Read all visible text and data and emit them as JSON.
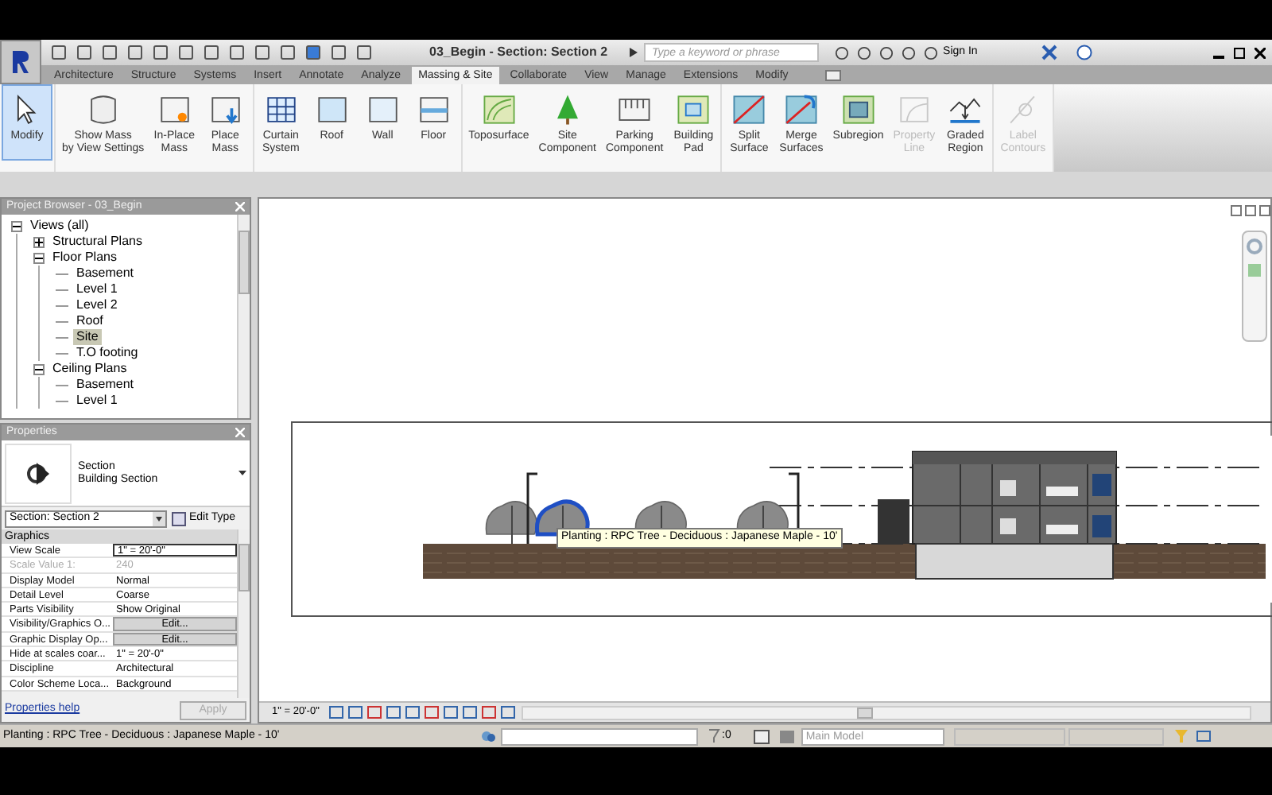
{
  "title_bar": {
    "document_title": "03_Begin - Section: Section 2",
    "search_placeholder": "Type a keyword or phrase",
    "sign_in": "Sign In"
  },
  "tabs": [
    {
      "label": "Architecture",
      "selected": false
    },
    {
      "label": "Structure",
      "selected": false
    },
    {
      "label": "Systems",
      "selected": false
    },
    {
      "label": "Insert",
      "selected": false
    },
    {
      "label": "Annotate",
      "selected": false
    },
    {
      "label": "Analyze",
      "selected": false
    },
    {
      "label": "Massing & Site",
      "selected": true
    },
    {
      "label": "Collaborate",
      "selected": false
    },
    {
      "label": "View",
      "selected": false
    },
    {
      "label": "Manage",
      "selected": false
    },
    {
      "label": "Extensions",
      "selected": false
    },
    {
      "label": "Modify",
      "selected": false
    }
  ],
  "ribbon": {
    "groups": [
      {
        "tools": [
          {
            "kind": "modify",
            "lines": [
              "Modify"
            ],
            "disabled": false,
            "selected": true
          }
        ]
      },
      {
        "tools": [
          {
            "kind": "mass",
            "lines": [
              "Show Mass",
              "by View Settings"
            ],
            "disabled": false,
            "selected": false
          },
          {
            "kind": "inplace",
            "lines": [
              "In-Place",
              "Mass"
            ],
            "disabled": false,
            "selected": false
          },
          {
            "kind": "place",
            "lines": [
              "Place",
              "Mass"
            ],
            "disabled": false,
            "selected": false
          }
        ]
      },
      {
        "tools": [
          {
            "kind": "curtain",
            "lines": [
              "Curtain",
              "System"
            ],
            "disabled": false,
            "selected": false
          },
          {
            "kind": "roof",
            "lines": [
              "Roof"
            ],
            "disabled": false,
            "selected": false
          },
          {
            "kind": "wall",
            "lines": [
              "Wall"
            ],
            "disabled": false,
            "selected": false
          },
          {
            "kind": "floor",
            "lines": [
              "Floor"
            ],
            "disabled": false,
            "selected": false
          }
        ]
      },
      {
        "tools": [
          {
            "kind": "topo",
            "lines": [
              "Toposurface"
            ],
            "disabled": false,
            "selected": false
          },
          {
            "kind": "tree",
            "lines": [
              "Site",
              "Component"
            ],
            "disabled": false,
            "selected": false
          },
          {
            "kind": "parking",
            "lines": [
              "Parking",
              "Component"
            ],
            "disabled": false,
            "selected": false
          },
          {
            "kind": "pad",
            "lines": [
              "Building",
              "Pad"
            ],
            "disabled": false,
            "selected": false
          }
        ]
      },
      {
        "tools": [
          {
            "kind": "split",
            "lines": [
              "Split",
              "Surface"
            ],
            "disabled": false,
            "selected": false
          },
          {
            "kind": "merge",
            "lines": [
              "Merge",
              "Surfaces"
            ],
            "disabled": false,
            "selected": false
          },
          {
            "kind": "subregion",
            "lines": [
              "Subregion"
            ],
            "disabled": false,
            "selected": false
          },
          {
            "kind": "propline",
            "lines": [
              "Property",
              "Line"
            ],
            "disabled": true,
            "selected": false
          },
          {
            "kind": "graded",
            "lines": [
              "Graded",
              "Region"
            ],
            "disabled": false,
            "selected": false
          }
        ]
      },
      {
        "tools": [
          {
            "kind": "contours",
            "lines": [
              "Label",
              "Contours"
            ],
            "disabled": true,
            "selected": false
          }
        ]
      }
    ]
  },
  "project_browser": {
    "title": "Project Browser - 03_Begin",
    "tree": [
      {
        "label": "Views (all)",
        "expanded": true,
        "selected": false,
        "children": [
          {
            "label": "Structural Plans",
            "expanded": false,
            "selected": false
          },
          {
            "label": "Floor Plans",
            "expanded": true,
            "selected": false,
            "children": [
              {
                "label": "Basement",
                "selected": false
              },
              {
                "label": "Level 1",
                "selected": false
              },
              {
                "label": "Level 2",
                "selected": false
              },
              {
                "label": "Roof",
                "selected": false
              },
              {
                "label": "Site",
                "selected": true
              },
              {
                "label": "T.O footing",
                "selected": false
              }
            ]
          },
          {
            "label": "Ceiling Plans",
            "expanded": true,
            "selected": false,
            "children": [
              {
                "label": "Basement",
                "selected": false
              },
              {
                "label": "Level 1",
                "selected": false
              }
            ]
          }
        ]
      }
    ]
  },
  "properties": {
    "title": "Properties",
    "type_lines": [
      "Section",
      "Building Section"
    ],
    "instance": "Section: Section 2",
    "edit_type": "Edit Type",
    "group": "Graphics",
    "rows": [
      {
        "name": "View Scale",
        "value": "1\" = 20'-0\"",
        "kind": "field",
        "disabled": false
      },
      {
        "name": "Scale Value    1:",
        "value": "240",
        "kind": "text",
        "disabled": true
      },
      {
        "name": "Display Model",
        "value": "Normal",
        "kind": "text",
        "disabled": false
      },
      {
        "name": "Detail Level",
        "value": "Coarse",
        "kind": "text",
        "disabled": false
      },
      {
        "name": "Parts Visibility",
        "value": "Show Original",
        "kind": "text",
        "disabled": false
      },
      {
        "name": "Visibility/Graphics O...",
        "value": "Edit...",
        "kind": "button",
        "disabled": false
      },
      {
        "name": "Graphic Display Op...",
        "value": "Edit...",
        "kind": "button",
        "disabled": false
      },
      {
        "name": "Hide at scales coar...",
        "value": "1\" = 20'-0\"",
        "kind": "text",
        "disabled": false
      },
      {
        "name": "Discipline",
        "value": "Architectural",
        "kind": "text",
        "disabled": false
      },
      {
        "name": "Color Scheme Loca...",
        "value": "Background",
        "kind": "text",
        "disabled": false
      }
    ],
    "help": "Properties help",
    "apply": "Apply",
    "apply_disabled": true
  },
  "canvas": {
    "tooltip": "Planting : RPC Tree - Deciduous : Japanese Maple - 10'",
    "view_scale": "1\" = 20'-0\""
  },
  "status_bar": {
    "message": "Planting : RPC Tree - Deciduous : Japanese Maple - 10'",
    "selection_count": ":0",
    "model": "Main Model"
  }
}
